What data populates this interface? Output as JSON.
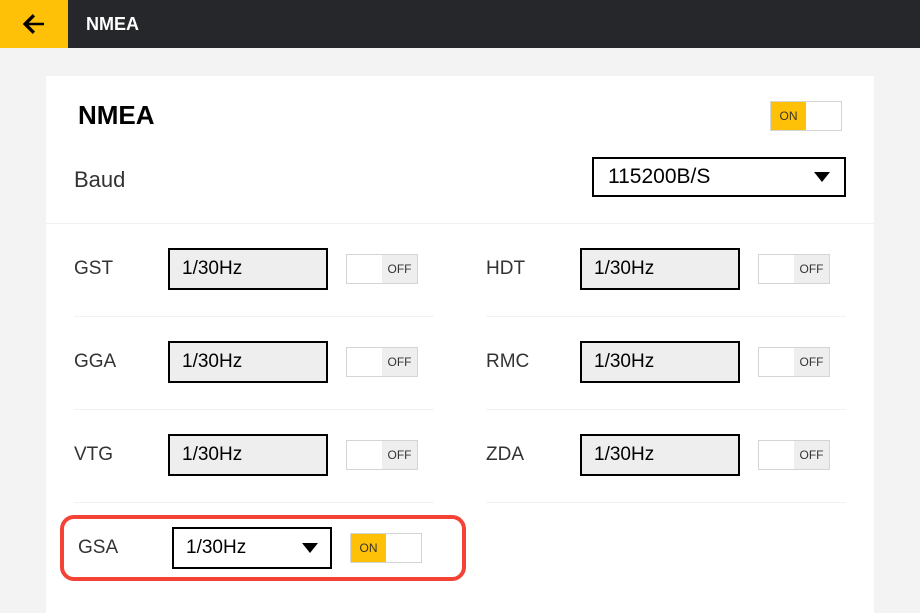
{
  "header": {
    "title": "NMEA"
  },
  "card": {
    "title": "NMEA",
    "toggle_state": "ON"
  },
  "baud": {
    "label": "Baud",
    "value": "115200B/S"
  },
  "rows": {
    "gst": {
      "label": "GST",
      "value": "1/30Hz",
      "toggle": "OFF"
    },
    "hdt": {
      "label": "HDT",
      "value": "1/30Hz",
      "toggle": "OFF"
    },
    "gga": {
      "label": "GGA",
      "value": "1/30Hz",
      "toggle": "OFF"
    },
    "rmc": {
      "label": "RMC",
      "value": "1/30Hz",
      "toggle": "OFF"
    },
    "vtg": {
      "label": "VTG",
      "value": "1/30Hz",
      "toggle": "OFF"
    },
    "zda": {
      "label": "ZDA",
      "value": "1/30Hz",
      "toggle": "OFF"
    },
    "gsa": {
      "label": "GSA",
      "value": "1/30Hz",
      "toggle": "ON"
    }
  }
}
